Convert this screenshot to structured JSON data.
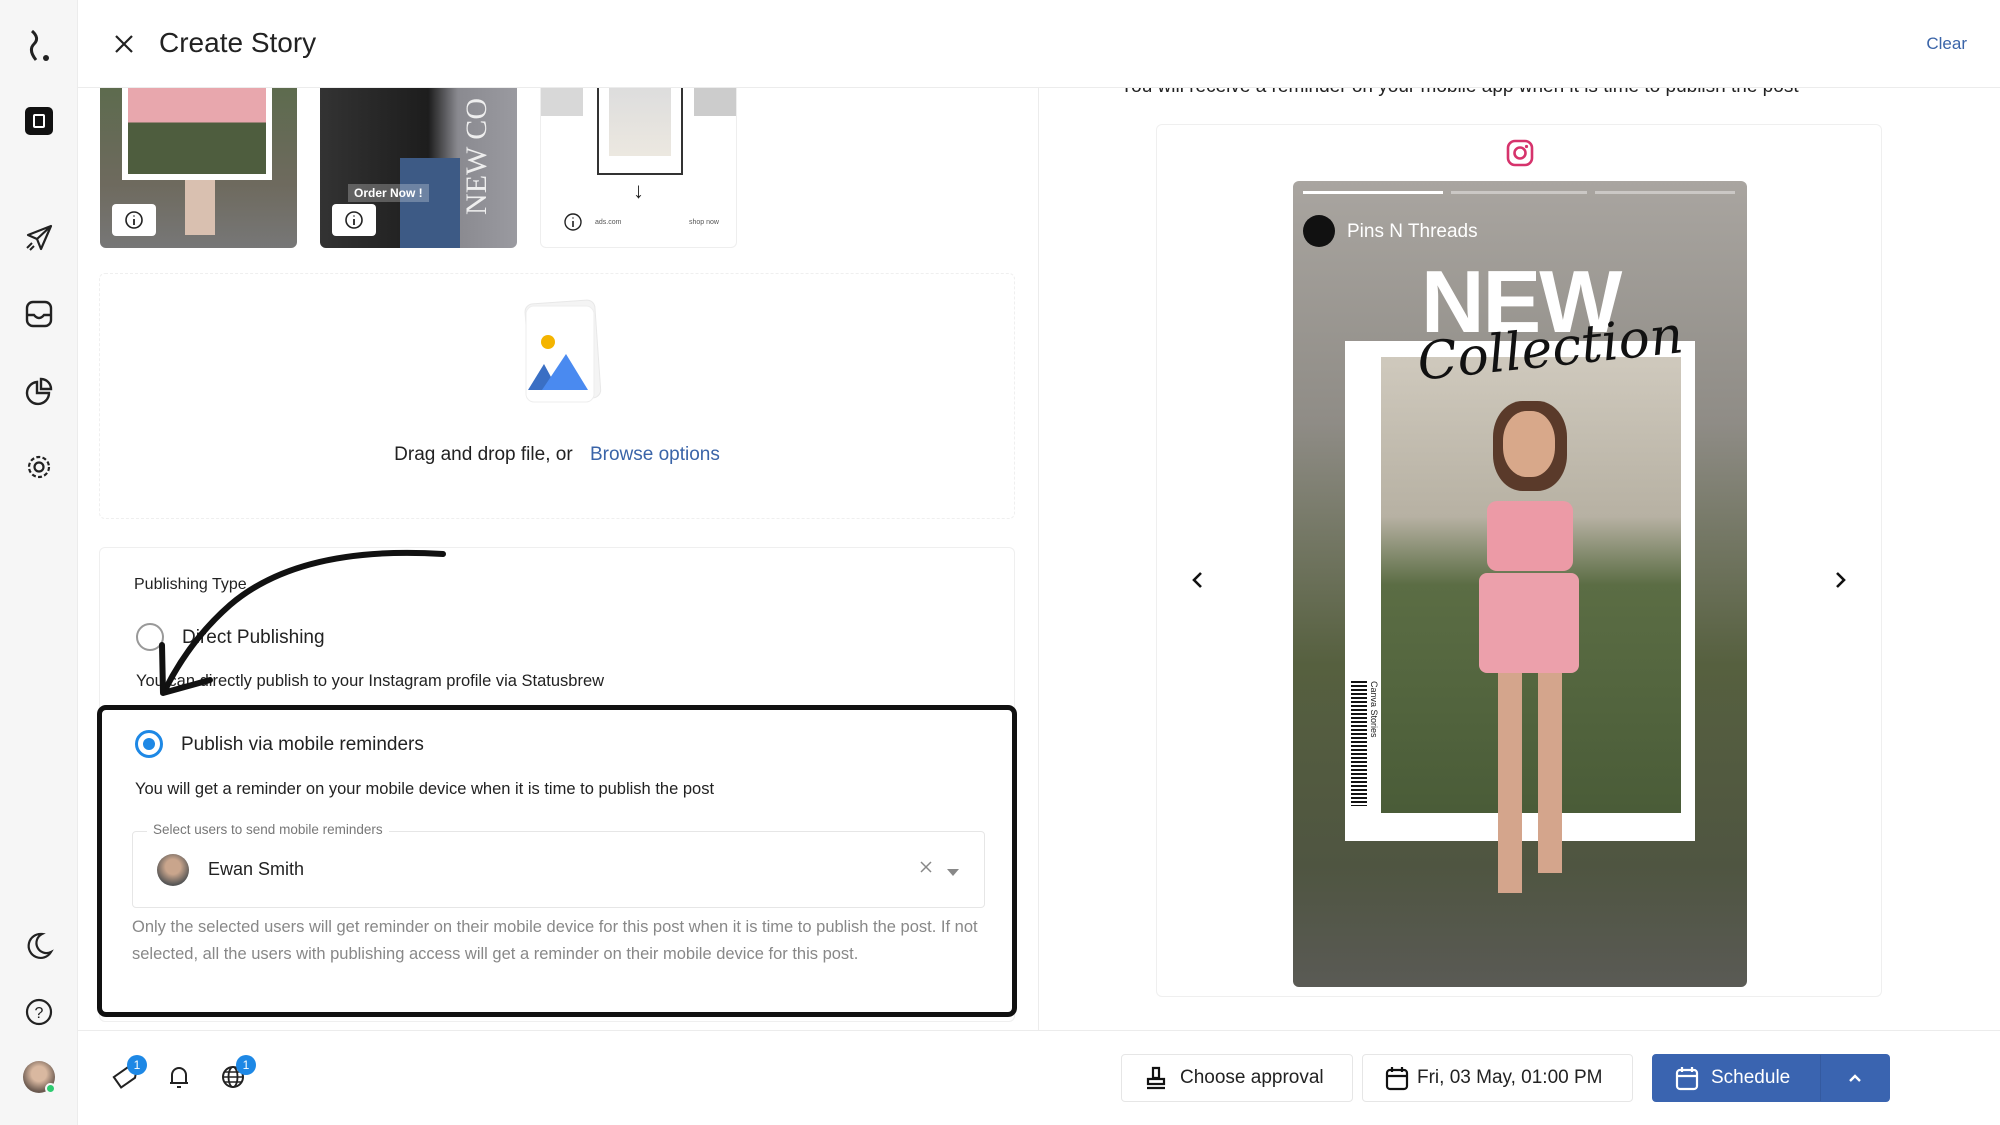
{
  "header": {
    "title": "Create Story",
    "clear_label": "Clear"
  },
  "thumbnails": [
    {
      "overlay": ""
    },
    {
      "overlay": "Order Now !",
      "side_text": "NEW CO"
    },
    {
      "left_text": "ads.com",
      "right_text": "shop now"
    }
  ],
  "dropzone": {
    "text": "Drag and drop file, or",
    "link": "Browse options"
  },
  "publishing": {
    "label": "Publishing Type",
    "options": [
      {
        "label": "Direct Publishing",
        "description": "You can directly publish to your Instagram profile via Statusbrew",
        "selected": false
      },
      {
        "label": "Publish via mobile reminders",
        "description": "You will get a reminder on your mobile device when it is time to publish the post",
        "selected": true
      }
    ],
    "select_label": "Select users to send mobile reminders",
    "selected_user": "Ewan Smith",
    "help": "Only the selected users will get reminder on their mobile device for this post when it is time to publish the post. If not selected, all the users with publishing access will get a reminder on their mobile device for this post."
  },
  "preview": {
    "bullet": "You will receive a reminder on your mobile app when it is time to publish the post",
    "account": "Pins N Threads",
    "story_title": "NEW",
    "story_subtitle": "Collection",
    "story_side": "Canva Stories",
    "instagram_color": "#d6336c"
  },
  "footer": {
    "tag_badge": "1",
    "globe_badge": "1",
    "approval_label": "Choose approval",
    "date_label": "Fri, 03 May, 01:00 PM",
    "schedule_label": "Schedule",
    "accent": "#3a64b0"
  }
}
